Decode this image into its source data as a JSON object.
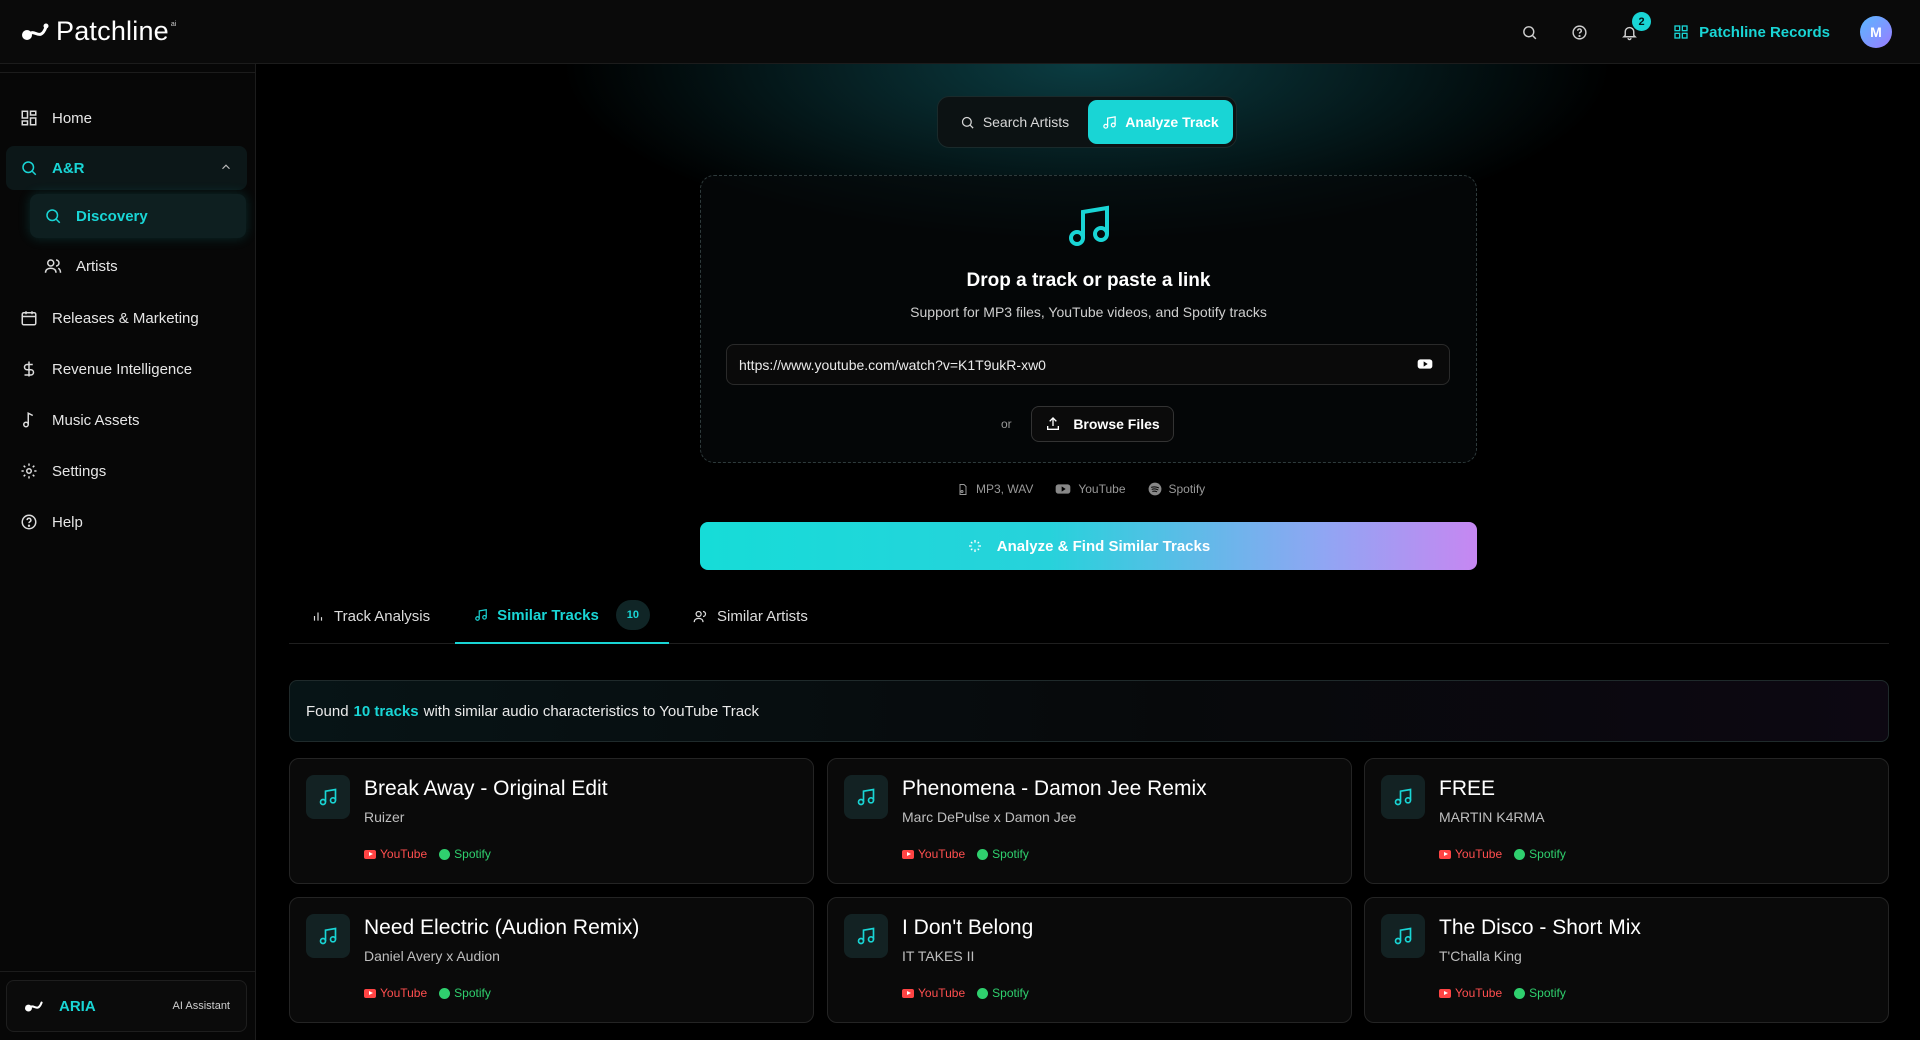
{
  "brand": {
    "name": "Patchline",
    "superscript": "ai"
  },
  "topbar": {
    "notification_count": "2",
    "org_name": "Patchline Records",
    "avatar_initial": "M"
  },
  "sidebar": {
    "items": [
      {
        "label": "Home"
      },
      {
        "label": "A&R"
      },
      {
        "label": "Discovery"
      },
      {
        "label": "Artists"
      },
      {
        "label": "Releases & Marketing"
      },
      {
        "label": "Revenue Intelligence"
      },
      {
        "label": "Music Assets"
      },
      {
        "label": "Settings"
      },
      {
        "label": "Help"
      }
    ],
    "assistant": {
      "name": "ARIA",
      "subtitle": "AI Assistant"
    }
  },
  "mode_toggle": {
    "search_label": "Search Artists",
    "analyze_label": "Analyze Track",
    "selected": "Analyze Track"
  },
  "dropzone": {
    "title": "Drop a track or paste a link",
    "subtitle": "Support for MP3 files, YouTube videos, and Spotify tracks",
    "url_value": "https://www.youtube.com/watch?v=K1T9ukR-xw0",
    "or_label": "or",
    "browse_label": "Browse Files"
  },
  "formats": [
    {
      "label": "MP3, WAV",
      "icon": "file-audio-icon"
    },
    {
      "label": "YouTube",
      "icon": "youtube-icon"
    },
    {
      "label": "Spotify",
      "icon": "spotify-icon"
    }
  ],
  "analyze_button": {
    "label": "Analyze & Find Similar Tracks"
  },
  "tabs": [
    {
      "label": "Track Analysis"
    },
    {
      "label": "Similar Tracks",
      "count": "10"
    },
    {
      "label": "Similar Artists"
    }
  ],
  "results": {
    "prefix": "Found",
    "highlight": "10 tracks",
    "suffix": "with similar audio characteristics to YouTube Track"
  },
  "tracks": [
    {
      "title": "Break Away - Original Edit",
      "artist": "Ruizer"
    },
    {
      "title": "Phenomena - Damon Jee Remix",
      "artist": "Marc DePulse x Damon Jee"
    },
    {
      "title": "FREE",
      "artist": "MARTIN K4RMA"
    },
    {
      "title": "Need Electric (Audion Remix)",
      "artist": "Daniel Avery x Audion"
    },
    {
      "title": "I Don't Belong",
      "artist": "IT TAKES II"
    },
    {
      "title": "The Disco - Short Mix",
      "artist": "T'Challa King"
    }
  ],
  "link_labels": {
    "youtube": "YouTube",
    "spotify": "Spotify"
  },
  "colors": {
    "accent": "#19d5d5",
    "background": "#000000",
    "youtube": "#ff4f4f",
    "spotify": "#2fd06e"
  }
}
